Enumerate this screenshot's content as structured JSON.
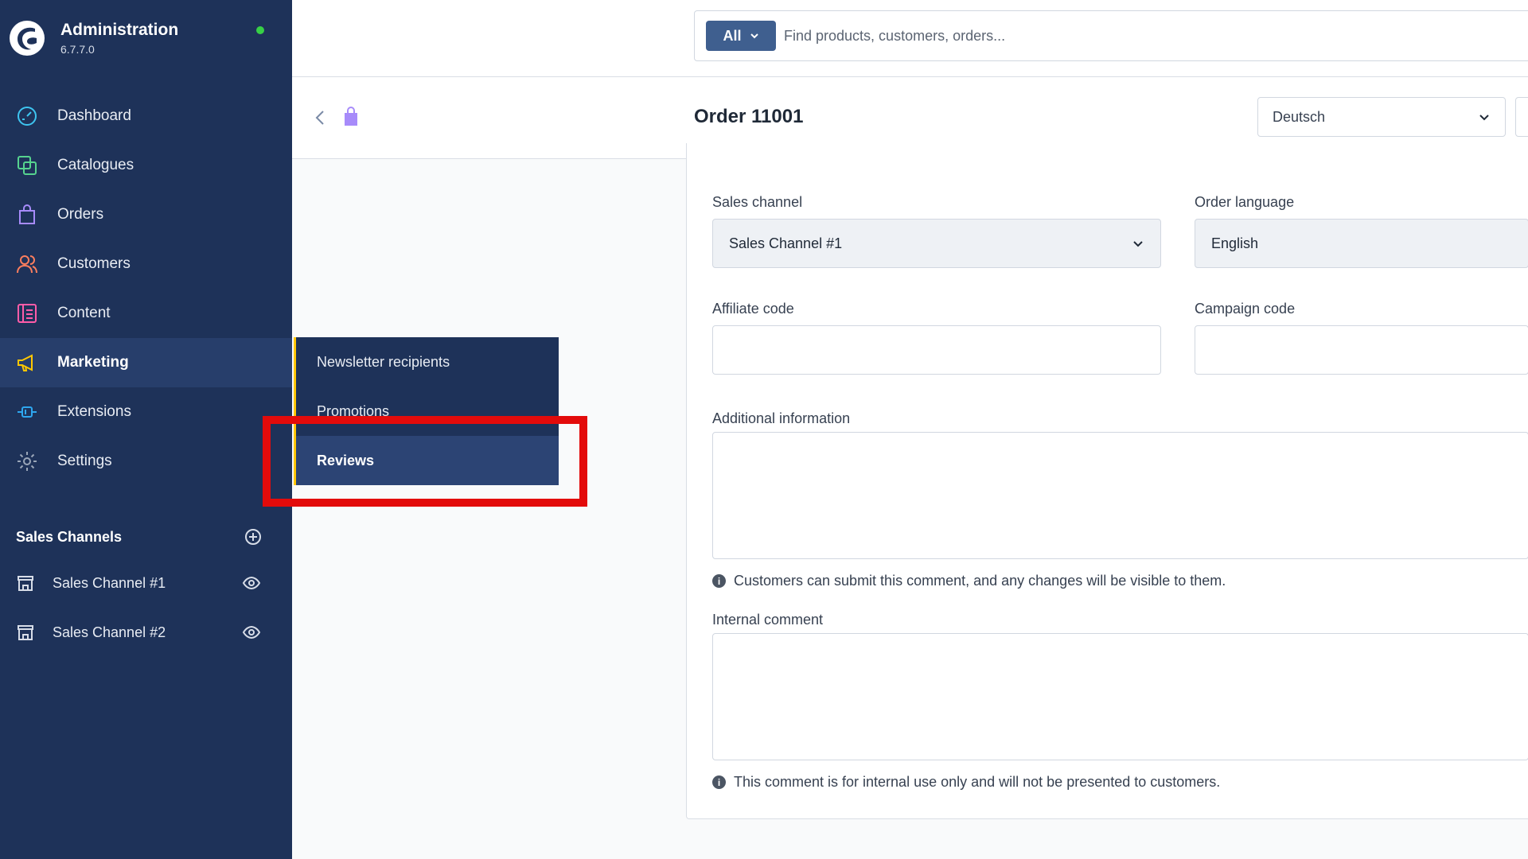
{
  "brand": {
    "title": "Administration",
    "version": "6.7.7.0"
  },
  "nav": {
    "items": [
      {
        "label": "Dashboard",
        "icon": "dashboard-icon"
      },
      {
        "label": "Catalogues",
        "icon": "catalogues-icon"
      },
      {
        "label": "Orders",
        "icon": "orders-icon"
      },
      {
        "label": "Customers",
        "icon": "customers-icon"
      },
      {
        "label": "Content",
        "icon": "content-icon"
      },
      {
        "label": "Marketing",
        "icon": "megaphone-icon",
        "active": true
      },
      {
        "label": "Extensions",
        "icon": "plug-icon"
      },
      {
        "label": "Settings",
        "icon": "gear-icon"
      }
    ]
  },
  "sales_channels": {
    "title": "Sales Channels",
    "items": [
      {
        "label": "Sales Channel #1"
      },
      {
        "label": "Sales Channel #2"
      }
    ]
  },
  "flyout": {
    "items": [
      {
        "label": "Newsletter recipients"
      },
      {
        "label": "Promotions"
      },
      {
        "label": "Reviews",
        "active": true
      }
    ]
  },
  "search": {
    "type_label": "All",
    "placeholder": "Find products, customers, orders..."
  },
  "header": {
    "title": "Order 11001",
    "language": "Deutsch"
  },
  "form": {
    "sales_channel": {
      "label": "Sales channel",
      "value": "Sales Channel #1"
    },
    "order_language": {
      "label": "Order language",
      "value": "English"
    },
    "affiliate_code": {
      "label": "Affiliate code",
      "value": ""
    },
    "campaign_code": {
      "label": "Campaign code",
      "value": ""
    },
    "additional_info": {
      "label": "Additional information",
      "value": "",
      "hint": "Customers can submit this comment, and any changes will be visible to them."
    },
    "internal_comment": {
      "label": "Internal comment",
      "value": "",
      "hint": "This comment is for internal use only and will not be presented to customers."
    }
  },
  "colors": {
    "sidebar_bg": "#1e3259",
    "active_bg": "#273e6b",
    "accent_yellow": "#ffc700",
    "highlight_red": "#e30b0b",
    "status_green": "#37d046"
  }
}
